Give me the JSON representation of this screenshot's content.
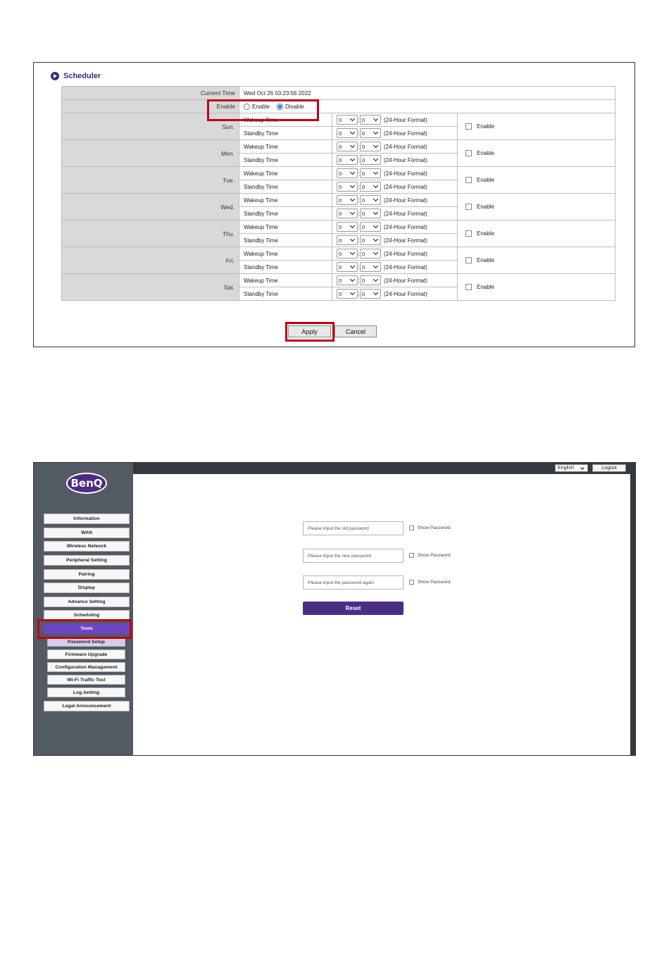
{
  "scheduler": {
    "title": "Scheduler",
    "current_time_label": "Current Time",
    "current_time_value": "Wed Oct 26 03:23:56 2022",
    "enable_label": "Enable",
    "enable_options": [
      "Enable",
      "Disable"
    ],
    "enable_selected": "Disable",
    "wakeup_label": "Wakeup Time",
    "standby_label": "Standby Time",
    "hour_value": "0",
    "minute_value": "0",
    "format_label": "(24-Hour Format)",
    "day_enable_label": "Enable",
    "days": [
      "Sun.",
      "Mon.",
      "Tue.",
      "Wed.",
      "Thu.",
      "Fri.",
      "Sat."
    ],
    "apply_label": "Apply",
    "cancel_label": "Cancel",
    "highlight_color": "#c00012"
  },
  "admin": {
    "logo_text": "BenQ",
    "language": "English",
    "logout_label": "Logout",
    "nav": {
      "information": "Information",
      "wan": "WAN",
      "wireless": "Wireless Network",
      "peripheral": "Peripheral Setting",
      "pairing": "Pairing",
      "display": "Display",
      "advance": "Advance Setting",
      "scheduling": "Scheduling",
      "tools": "Tools",
      "password_setup": "Password Setup",
      "firmware": "Firmware Upgrade",
      "config": "Configuration Management",
      "wifi_test": "Wi-Fi Traffic Test",
      "log": "Log Setting",
      "legal": "Legal Announcement"
    },
    "form": {
      "old_placeholder": "Please input the old password",
      "new_placeholder": "Please input the new password",
      "again_placeholder": "Please input the password again",
      "show_password": "Show Password",
      "reset_label": "Reset"
    },
    "accent_color": "#6b46c1",
    "brand_color": "#4b2d86"
  }
}
